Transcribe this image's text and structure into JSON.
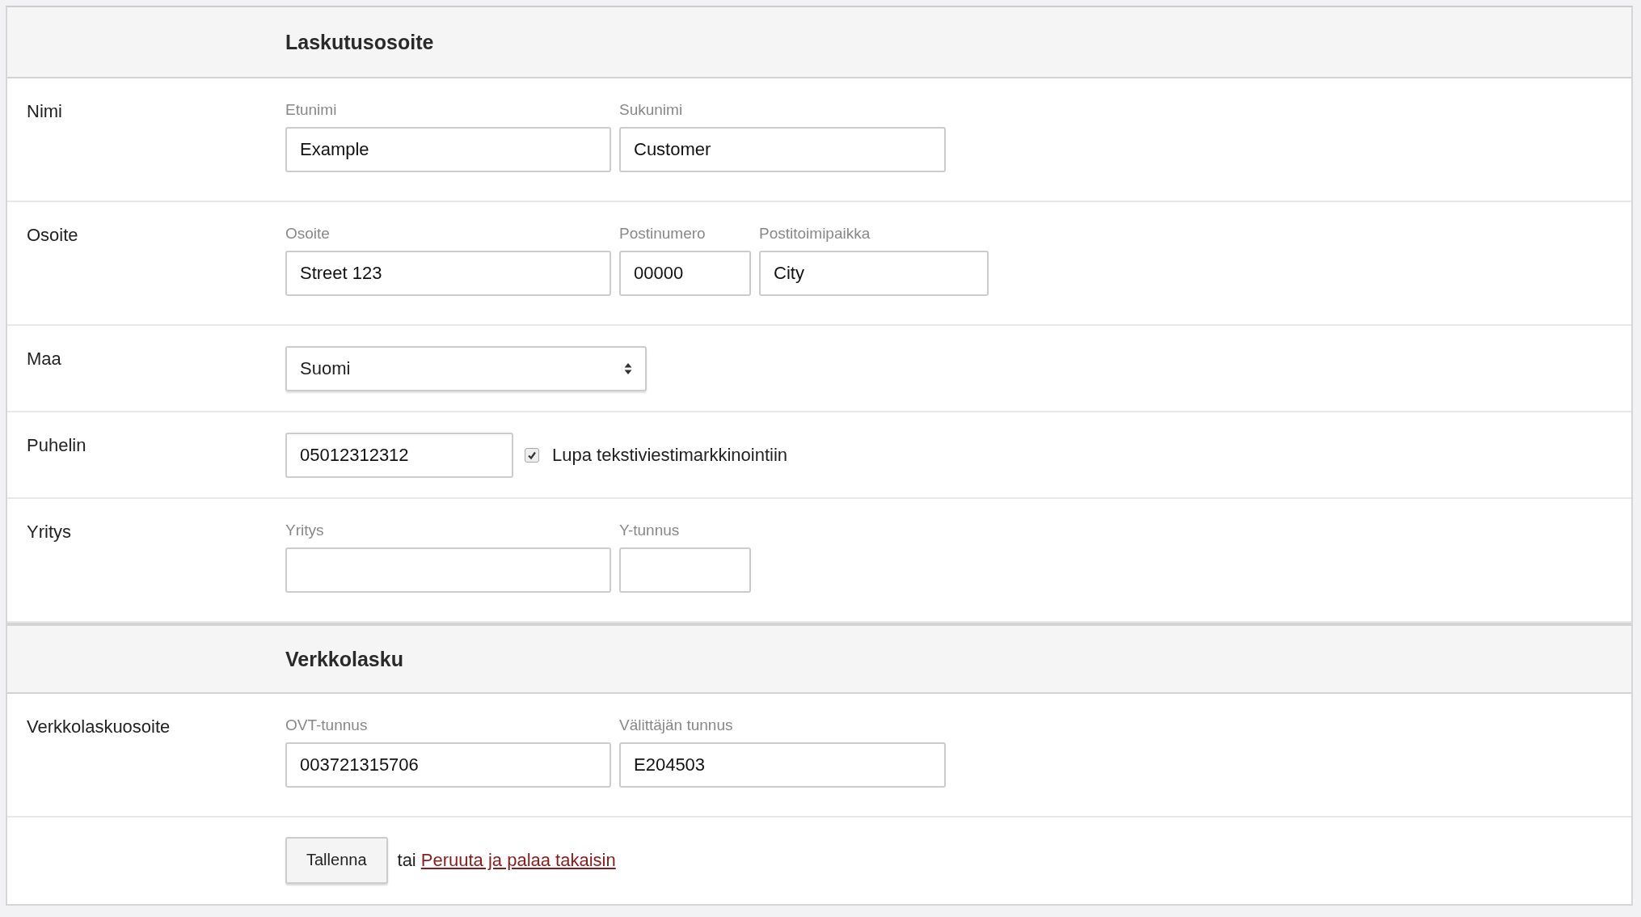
{
  "sections": [
    {
      "title": "Laskutusosoite",
      "rows": [
        {
          "kind": "fields",
          "label": "Nimi",
          "fields": [
            {
              "label": "Etunimi",
              "value": "Example"
            },
            {
              "label": "Sukunimi",
              "value": "Customer"
            }
          ]
        },
        {
          "kind": "fields",
          "label": "Osoite",
          "fields": [
            {
              "label": "Osoite",
              "value": "Street 123"
            },
            {
              "label": "Postinumero",
              "value": "00000"
            },
            {
              "label": "Postitoimipaikka",
              "value": "City"
            }
          ]
        },
        {
          "kind": "select",
          "label": "Maa",
          "value": "Suomi"
        },
        {
          "kind": "phone",
          "label": "Puhelin",
          "value": "05012312312",
          "checkbox": {
            "label": "Lupa tekstiviestimarkkinointiin",
            "checked": true
          }
        },
        {
          "kind": "fields",
          "label": "Yritys",
          "fields": [
            {
              "label": "Yritys"
            },
            {
              "label": "Y-tunnus"
            }
          ]
        }
      ]
    },
    {
      "title": "Verkkolasku",
      "rows": [
        {
          "kind": "fields",
          "label": "Verkkolaskuosoite",
          "fields": [
            {
              "label": "OVT-tunnus",
              "value": "003721315706"
            },
            {
              "label": "Välittäjän tunnus",
              "value": "E204503"
            }
          ]
        },
        {
          "kind": "actions",
          "button": "Tallenna",
          "text": "tai",
          "link": "Peruuta ja palaa takaisin"
        }
      ]
    }
  ]
}
